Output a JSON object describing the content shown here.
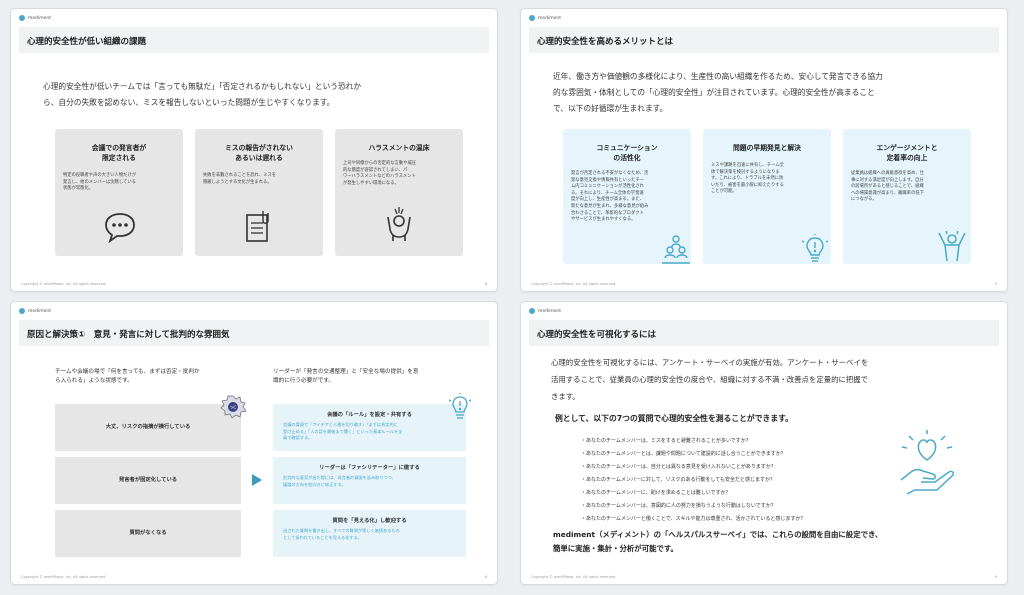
{
  "brand": "mediment",
  "footer": "Copyright © mediPhone, Inc. All rights reserved.",
  "accent": "#4aa9c9",
  "slide1": {
    "title": "心理的安全性が低い組織の課題",
    "body_l1": "心理的安全性が低いチームでは「言っても無駄だ」「否定されるかもしれない」という恐れか",
    "body_l2": "ら、自分の失敗を認めない、ミスを報告しないといった問題が生じやすくなります。",
    "cards": [
      {
        "t1": "会議での発言者が",
        "t2": "限定される",
        "d": [
          "特定の役職者や声の大きい人物だけが",
          "発言し、他のメンバーは沈黙している",
          "状態が常態化。"
        ],
        "icon": "speech-bubble-icon"
      },
      {
        "t1": "ミスの報告がされない",
        "t2": "あるいは遅れる",
        "d": [
          "失敗を非難されることを恐れ、ミスを",
          "隠蔽しようとする文化が生まれる。"
        ],
        "icon": "document-clip-icon"
      },
      {
        "t1": "ハラスメントの温床",
        "t2": "",
        "d": [
          "上司や同僚からの否定的な言動や威圧",
          "的な態度が容認されてしまい、パ",
          "ワーハラスメントなどのハラスメント",
          "が発生しやすい環境になる。"
        ],
        "icon": "stressed-person-icon"
      }
    ],
    "page": "8"
  },
  "slide2": {
    "title": "心理的安全性を高めるメリットとは",
    "body_l1": "近年、働き方や価値観の多様化により、生産性の高い組織を作るため、安心して発言できる協力",
    "body_l2": "的な雰囲気・体制としての「心理的安全性」が注目されています。心理的安全性が高まること",
    "body_l3": "で、以下の好循環が生まれます。",
    "cards": [
      {
        "t1": "コミュニケーション",
        "t2": "の活性化",
        "d": [
          "発言が否定される不安がなくなため、活",
          "発な意見交換や情報共有といったチー",
          "ム内コミュニケーションが活性化され",
          "る。それにより、チーム全体の学習速",
          "度が向上し、生産性が高まる。また、",
          "新たな意見が生まれ、多様な意見が組み",
          "合わさることで、革新的なプロダクト",
          "やサービスが生まれやすくなる。"
        ],
        "icon": "team-pyramid-icon"
      },
      {
        "t1": "問題の早期発見と解決",
        "t2": "",
        "d": [
          "ミスや課題を迅速に共有し、チーム全",
          "体で解決策を検討するようになりま",
          "す。これにより、トラブルを未然に防",
          "いだり、被害を最小限に抑えたりする",
          "ことが可能。"
        ],
        "icon": "lightbulb-icon"
      },
      {
        "t1": "エンゲージメントと",
        "t2": "定着率の向上",
        "d": [
          "従業員は組織への貢献意欲を高め、仕",
          "事に対する満足度が向上します。自分",
          "の居場所があると感じることで、組織",
          "への帰属意識が高まり、離職率の低下",
          "につながる。"
        ],
        "icon": "cheering-person-icon"
      }
    ],
    "page": "9"
  },
  "slide3": {
    "title": "原因と解決策①　意見・発言に対して批判的な雰囲気",
    "left_l1": "チームや会議の場で「何を言っても、まずは否定・批判か",
    "left_l2": "ら入られる」ような状態です。",
    "right_l1": "リーダーが「発言の交通整理」と「安全な場の提供」を意",
    "right_l2": "識的に行う必要がです。",
    "problems": [
      "大丈、リスクの指摘が横行している",
      "発言者が固定化している",
      "質問がなくなる"
    ],
    "solutions": [
      {
        "t": "会議の「ルール」を設定・共有する",
        "d": [
          "会議の冒頭で「アイデアと人格を切り離す」「まずは肯定的に",
          "受け止める」「人の話を最後まで聞く」といった基本ルールを全",
          "員で確認する。"
        ]
      },
      {
        "t": "リーダーは「ファシリテーター」に徹する",
        "d": [
          "批判的な意見が出た際には、発言者の意図を汲み取りつつ、",
          "議論の方向を前向きに修正する。"
        ]
      },
      {
        "t": "質問を「見える化」し歓迎する",
        "d": [
          "出された質問を書き出し、すべての質問が等しく価値あるもの",
          "として扱われていることを見える化する。"
        ]
      }
    ],
    "page": "8"
  },
  "slide4": {
    "title": "心理的安全性を可視化するには",
    "body_l1": "心理的安全性を可視化するには、アンケート・サーベイの実施が有効。アンケート・サーベイを",
    "body_l2": "活用することで、従業員の心理的安全性の度合や、組織に対する不満・改善点を定量的に把握で",
    "body_l3": "きます。",
    "lead": "例として、以下の7つの質問で心理的安全性を測ることができます。",
    "questions": [
      "・あなたのチームメンバーは、ミスをすると避難されることが多いですか？",
      "・あなたのチームメンバーとは、課題や問題について建設的に話し合うことができますか？",
      "・あなたのチームメンバーは、自分とは異なる意見を受け入れないことがありますか？",
      "・あなたのチームメンバーに対して、リスクのある行動をしても安全だと感じますか？",
      "・あなたのチームメンバーに、助けを求めることは難しいですか？",
      "・あなたのチームメンバーは、意図的に人の努力を損なうような行動はしないですか？",
      "・あなたのチームメンバーと働くことで、スキルや能力は尊重され、活かされていると感じますか？"
    ],
    "bottom_l1": "mediment（メディメント）の「ヘルスパルスサーベイ」では、これらの設問を自由に設定でき、",
    "bottom_l2": "簡単に実施・集計・分析が可能です。",
    "page": "9"
  }
}
